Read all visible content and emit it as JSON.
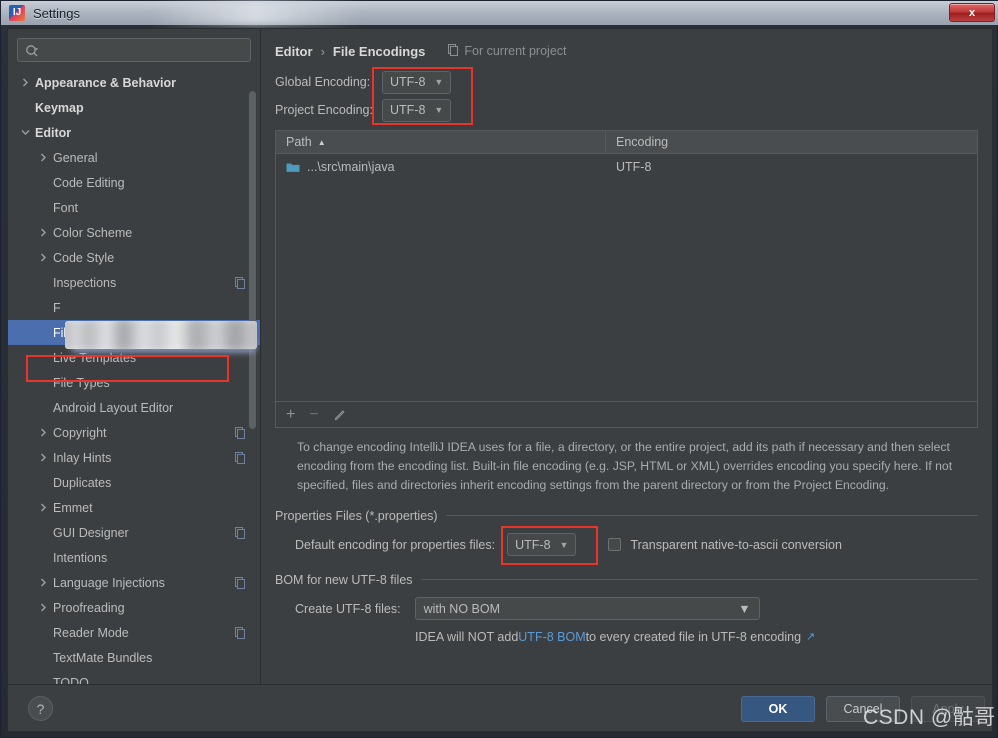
{
  "window": {
    "title": "Settings",
    "app_icon": "intellij-idea-icon",
    "close_label": "x"
  },
  "sidebar": {
    "search": {
      "placeholder": "",
      "value": "",
      "icon": "search-icon"
    },
    "items": [
      {
        "label": "Appearance & Behavior",
        "level": 0,
        "arrow": "right",
        "bold": true,
        "badge": false
      },
      {
        "label": "Keymap",
        "level": 0,
        "arrow": "none",
        "bold": true,
        "badge": false
      },
      {
        "label": "Editor",
        "level": 0,
        "arrow": "down",
        "bold": true,
        "badge": false
      },
      {
        "label": "General",
        "level": 1,
        "arrow": "right",
        "bold": false,
        "badge": false
      },
      {
        "label": "Code Editing",
        "level": 1,
        "arrow": "none",
        "bold": false,
        "badge": false
      },
      {
        "label": "Font",
        "level": 1,
        "arrow": "none",
        "bold": false,
        "badge": false
      },
      {
        "label": "Color Scheme",
        "level": 1,
        "arrow": "right",
        "bold": false,
        "badge": false
      },
      {
        "label": "Code Style",
        "level": 1,
        "arrow": "right",
        "bold": false,
        "badge": false
      },
      {
        "label": "Inspections",
        "level": 1,
        "arrow": "none",
        "bold": false,
        "badge": true
      },
      {
        "label": "F",
        "level": 1,
        "arrow": "none",
        "bold": false,
        "badge": false
      },
      {
        "label": "File Encodings",
        "level": 1,
        "arrow": "none",
        "bold": false,
        "badge": true,
        "selected": true
      },
      {
        "label": "Live Templates",
        "level": 1,
        "arrow": "none",
        "bold": false,
        "badge": false
      },
      {
        "label": "File Types",
        "level": 1,
        "arrow": "none",
        "bold": false,
        "badge": false
      },
      {
        "label": "Android Layout Editor",
        "level": 1,
        "arrow": "none",
        "bold": false,
        "badge": false
      },
      {
        "label": "Copyright",
        "level": 1,
        "arrow": "right",
        "bold": false,
        "badge": true
      },
      {
        "label": "Inlay Hints",
        "level": 1,
        "arrow": "right",
        "bold": false,
        "badge": true
      },
      {
        "label": "Duplicates",
        "level": 1,
        "arrow": "none",
        "bold": false,
        "badge": false
      },
      {
        "label": "Emmet",
        "level": 1,
        "arrow": "right",
        "bold": false,
        "badge": false
      },
      {
        "label": "GUI Designer",
        "level": 1,
        "arrow": "none",
        "bold": false,
        "badge": true
      },
      {
        "label": "Intentions",
        "level": 1,
        "arrow": "none",
        "bold": false,
        "badge": false
      },
      {
        "label": "Language Injections",
        "level": 1,
        "arrow": "right",
        "bold": false,
        "badge": true
      },
      {
        "label": "Proofreading",
        "level": 1,
        "arrow": "right",
        "bold": false,
        "badge": false
      },
      {
        "label": "Reader Mode",
        "level": 1,
        "arrow": "none",
        "bold": false,
        "badge": true
      },
      {
        "label": "TextMate Bundles",
        "level": 1,
        "arrow": "none",
        "bold": false,
        "badge": false
      },
      {
        "label": "TODO",
        "level": 1,
        "arrow": "none",
        "bold": false,
        "badge": false
      }
    ]
  },
  "main": {
    "breadcrumb": {
      "parent": "Editor",
      "separator": "›",
      "current": "File Encodings"
    },
    "project_hint": {
      "icon": "copy-scope-icon",
      "label": "For current project"
    },
    "global_encoding": {
      "label": "Global Encoding:",
      "value": "UTF-8",
      "caret": "▼"
    },
    "project_encoding": {
      "label": "Project Encoding:",
      "value": "UTF-8",
      "caret": "▼"
    },
    "table": {
      "columns": [
        "Path",
        "Encoding"
      ],
      "sort_column": "Path",
      "sort_direction": "▲",
      "rows": [
        {
          "icon": "folder-icon",
          "path": "...\\src\\main\\java",
          "encoding": "UTF-8"
        }
      ]
    },
    "table_toolbar": {
      "add": "+",
      "remove": "−",
      "edit": "✎"
    },
    "description": "To change encoding IntelliJ IDEA uses for a file, a directory, or the entire project, add its path if necessary and then select encoding from the encoding list. Built-in file encoding (e.g. JSP, HTML or XML) overrides encoding you specify here. If not specified, files and directories inherit encoding settings from the parent directory or from the Project Encoding.",
    "properties_section": {
      "title": "Properties Files (*.properties)",
      "default_encoding_label": "Default encoding for properties files:",
      "default_encoding_value": "UTF-8",
      "caret": "▼",
      "checkbox_label": "Transparent native-to-ascii conversion",
      "checkbox_checked": false
    },
    "bom_section": {
      "title": "BOM for new UTF-8 files",
      "create_label": "Create UTF-8 files:",
      "create_value": "with NO BOM",
      "caret": "▼",
      "note_prefix": "IDEA will NOT add ",
      "note_link": "UTF-8 BOM",
      "note_suffix": " to every created file in UTF-8 encoding",
      "note_external_icon": "↗"
    }
  },
  "footer": {
    "help": "?",
    "ok": "OK",
    "cancel": "Cancel",
    "apply": "Apply"
  },
  "watermark": "CSDN @骷哥",
  "colors": {
    "panel_bg": "#3c3f41",
    "selection_blue": "#4b6eaf",
    "ok_button_blue": "#365880",
    "annotation_red": "#e8352b",
    "link_blue": "#5a9bd5",
    "folder_teal": "#4e9bc0"
  }
}
